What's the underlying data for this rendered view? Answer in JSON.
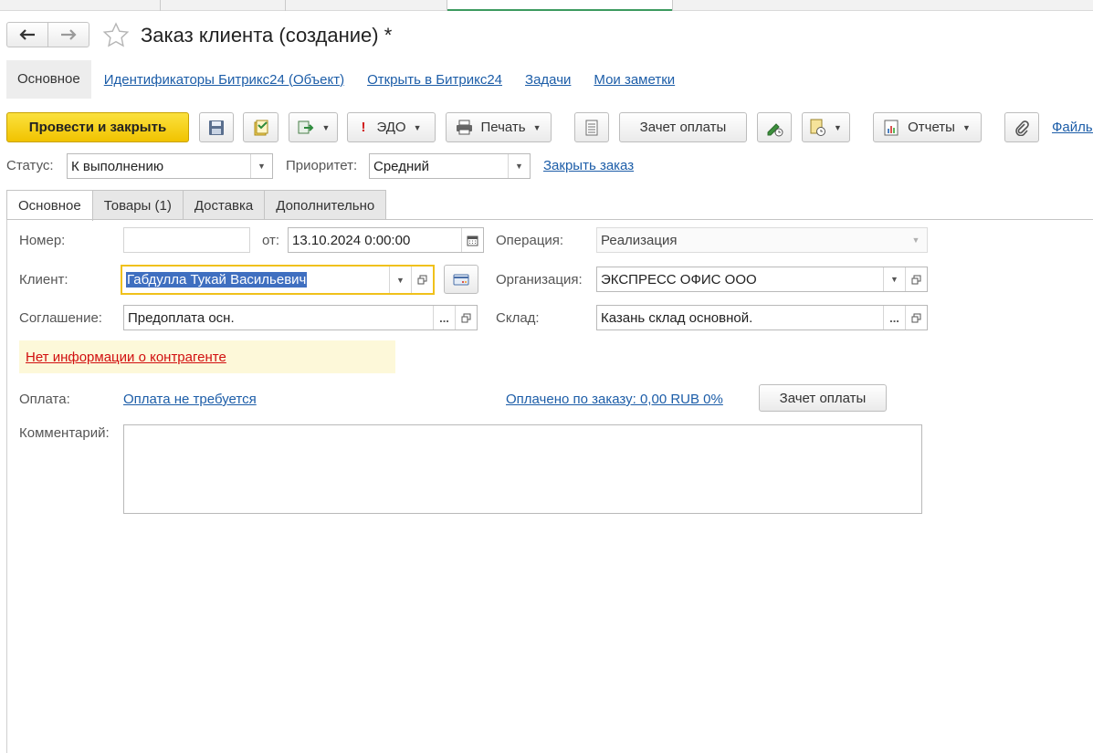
{
  "window": {
    "title": "Заказ клиента (создание) *"
  },
  "nav": {
    "back_icon": "arrow-left-icon",
    "forward_icon": "arrow-right-icon",
    "favorite_icon": "star-icon"
  },
  "page_links": {
    "active": "Основное",
    "items": [
      "Идентификаторы Битрикс24 (Объект)",
      "Открыть в Битрикс24",
      "Задачи",
      "Мои заметки"
    ]
  },
  "toolbar": {
    "post_and_close": "Провести и закрыть",
    "edo": "ЭДО",
    "print": "Печать",
    "payment_offset": "Зачет оплаты",
    "reports": "Отчеты",
    "files": "Файлы"
  },
  "status_bar": {
    "status_label": "Статус:",
    "status_value": "К выполнению",
    "priority_label": "Приоритет:",
    "priority_value": "Средний",
    "close_order_link": "Закрыть заказ"
  },
  "tabs": [
    "Основное",
    "Товары (1)",
    "Доставка",
    "Дополнительно"
  ],
  "form": {
    "number_label": "Номер:",
    "number_value": "",
    "date_label": "от:",
    "date_value": "13.10.2024  0:00:00",
    "operation_label": "Операция:",
    "operation_value": "Реализация",
    "client_label": "Клиент:",
    "client_value": "Габдулла Тукай Васильевич",
    "organization_label": "Организация:",
    "organization_value": "ЭКСПРЕСС ОФИС ООО",
    "agreement_label": "Соглашение:",
    "agreement_value": "Предоплата осн.",
    "warehouse_label": "Склад:",
    "warehouse_value": "Казань склад основной.",
    "warning_link": "Нет информации о контрагенте",
    "payment_label": "Оплата:",
    "payment_link": "Оплата не требуется",
    "paid_link": "Оплачено по заказу: 0,00 RUB 0%",
    "payment_offset_button": "Зачет оплаты",
    "comment_label": "Комментарий:",
    "comment_value": ""
  },
  "colors": {
    "primary_button": "#f7d117",
    "link": "#1c5da8",
    "warning_text": "#d10f0f",
    "warning_bg": "#fdf8d9",
    "focus_border": "#f0c11b",
    "selection": "#3f6fc0"
  }
}
